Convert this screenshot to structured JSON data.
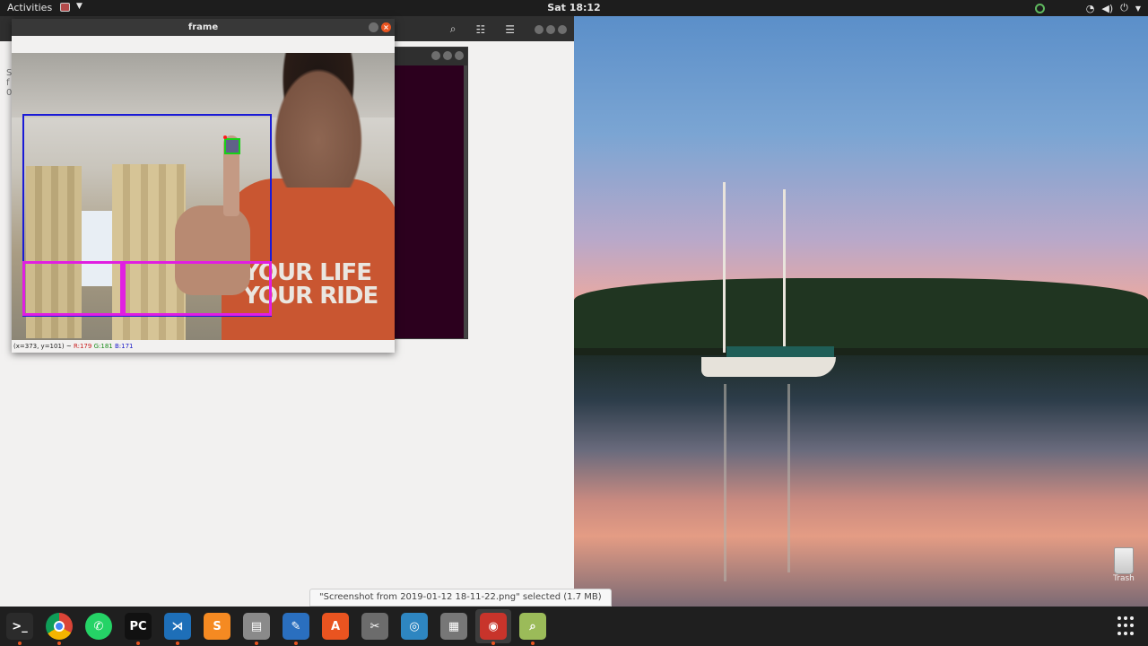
{
  "topbar": {
    "activities": "Activities",
    "clock": "Sat 18:12"
  },
  "frame_window": {
    "title": "frame",
    "status": {
      "coords": "(x=373, y=101) ~ ",
      "r": "R:179",
      "g": "G:181",
      "b": "B:171"
    },
    "shirt_print_line1": "YOUR LIFE",
    "shirt_print_line2": "YOUR RIDE"
  },
  "file_manager": {
    "sidebar_fragments": [
      "S",
      "f",
      "0"
    ],
    "status_message": "\"Screenshot from 2019-01-12 18-11-22.png\" selected  (1.7 MB)"
  },
  "desktop": {
    "trash_label": "Trash"
  },
  "dock": {
    "items": [
      {
        "name": "terminal",
        "glyph": ">_",
        "color": "#2b2b2b",
        "running": true
      },
      {
        "name": "chrome",
        "glyph": "",
        "color": "#db4437",
        "running": true
      },
      {
        "name": "whatsapp",
        "glyph": "✆",
        "color": "#25d366",
        "running": false
      },
      {
        "name": "pycharm",
        "glyph": "PC",
        "color": "#111111",
        "running": true
      },
      {
        "name": "vscode",
        "glyph": "⋊",
        "color": "#1e6fb8",
        "running": true
      },
      {
        "name": "sublime",
        "glyph": "S",
        "color": "#f58a22",
        "running": false
      },
      {
        "name": "files",
        "glyph": "▤",
        "color": "#8a8a8a",
        "running": true
      },
      {
        "name": "writer",
        "glyph": "✎",
        "color": "#2a6fbf",
        "running": true
      },
      {
        "name": "software",
        "glyph": "A",
        "color": "#e95420",
        "running": false
      },
      {
        "name": "screenshot-tool",
        "glyph": "✂",
        "color": "#6c6c6c",
        "running": false
      },
      {
        "name": "shutter",
        "glyph": "◎",
        "color": "#2e86c1",
        "running": false
      },
      {
        "name": "calculator",
        "glyph": "▦",
        "color": "#777777",
        "running": false
      },
      {
        "name": "frame-app",
        "glyph": "◉",
        "color": "#c8342b",
        "running": true
      },
      {
        "name": "image-viewer",
        "glyph": "⌕",
        "color": "#9bbb59",
        "running": true
      }
    ]
  },
  "colors": {
    "roi_blue": "#1a1ad6",
    "roi_pink": "#e11ee1",
    "marker_green": "#18d018",
    "ubuntu_orange": "#e95420"
  }
}
